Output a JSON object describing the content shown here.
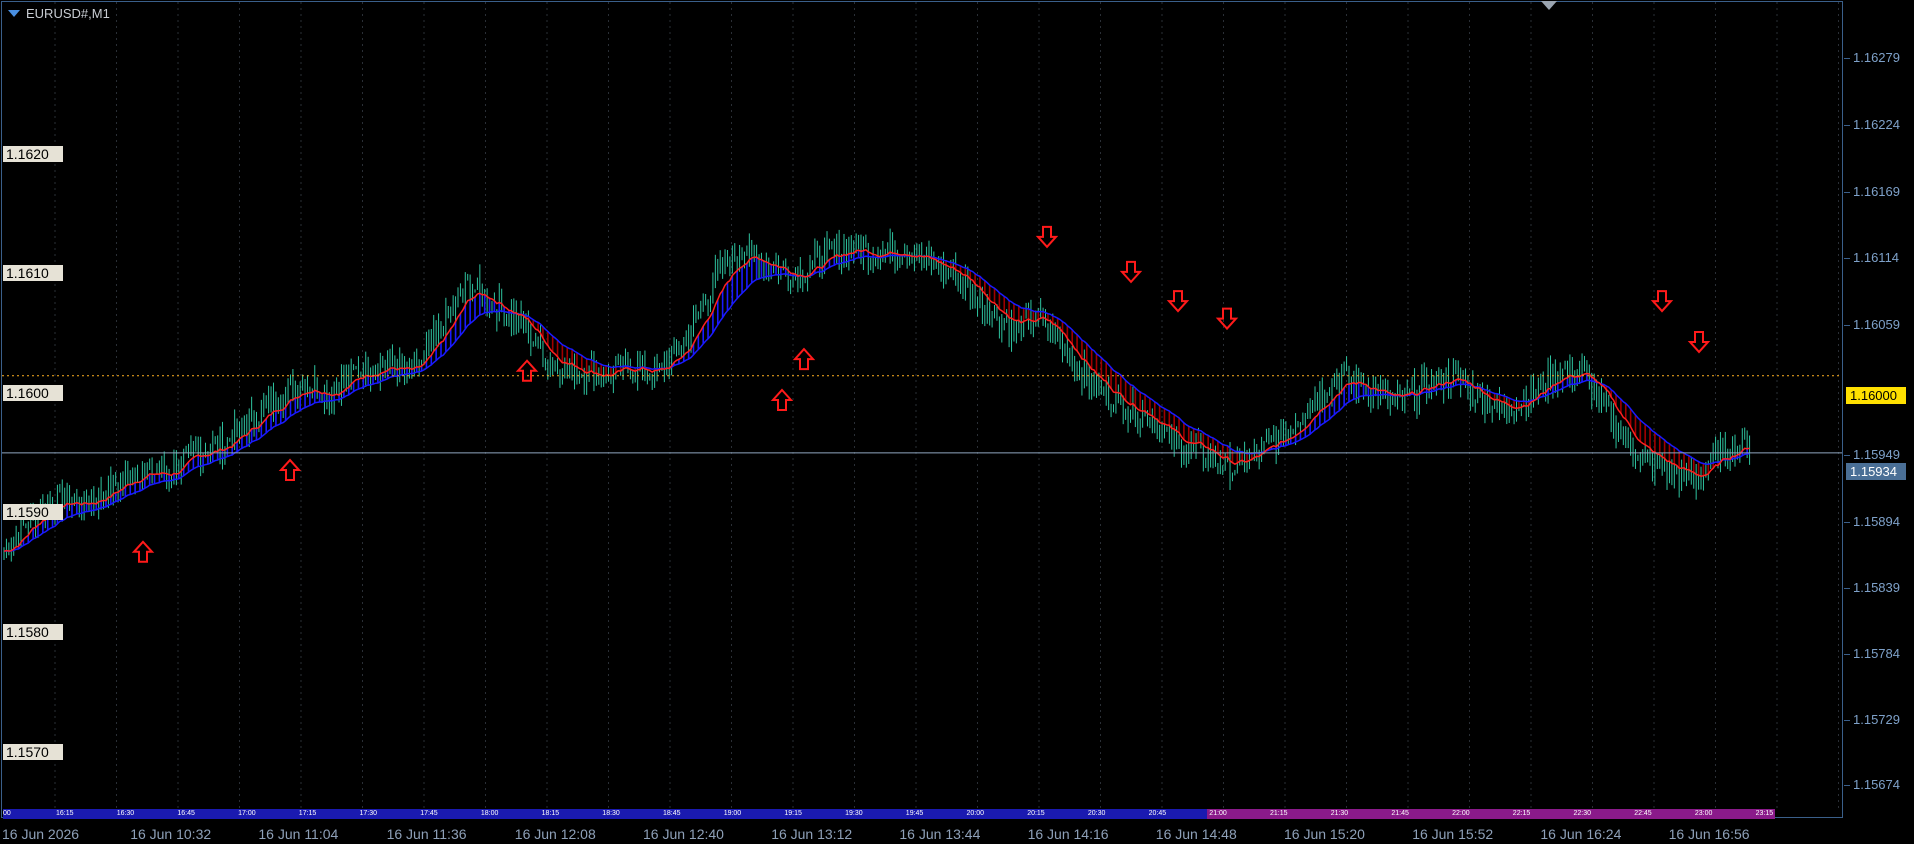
{
  "window": {
    "symbol_title": "EURUSD#,M1"
  },
  "colors": {
    "background": "#000000",
    "candle": "#2ec4a0",
    "ma_fast": "#ff2020",
    "ma_slow": "#1a1aff",
    "fill_up": "#1a1aff",
    "fill_down": "#a00000",
    "signal_arrow": "#ff1a1a",
    "round_level_line": "#ffb020",
    "current_price_line": "#8fa7bf",
    "session_blue": "#1a1ab0",
    "session_purple": "#8a1a8a"
  },
  "price_scale": {
    "labels": [
      "1.16279",
      "1.16224",
      "1.16169",
      "1.16114",
      "1.16059",
      "1.15949",
      "1.15894",
      "1.15839",
      "1.15784",
      "1.15729",
      "1.15674"
    ],
    "current_price": "1.15934",
    "round_level": "1.16000"
  },
  "level_tags": [
    "1.1620",
    "1.1610",
    "1.1600",
    "1.1590",
    "1.1580",
    "1.1570"
  ],
  "session_bar": {
    "labels": [
      "00",
      "16:15",
      "16:30",
      "16:45",
      "17:00",
      "17:15",
      "17:30",
      "17:45",
      "18:00",
      "18:15",
      "18:30",
      "18:45",
      "19:00",
      "19:15",
      "19:30",
      "19:45",
      "20:00",
      "20:15",
      "20:30",
      "20:45",
      "21:00",
      "21:15",
      "21:30",
      "21:45",
      "22:00",
      "22:15",
      "22:30",
      "22:45",
      "23:00",
      "23:15"
    ]
  },
  "time_axis": {
    "labels": [
      "16 Jun 2026",
      "16 Jun 10:32",
      "16 Jun 11:04",
      "16 Jun 11:36",
      "16 Jun 12:08",
      "16 Jun 12:40",
      "16 Jun 13:12",
      "16 Jun 13:44",
      "16 Jun 14:16",
      "16 Jun 14:48",
      "16 Jun 15:20",
      "16 Jun 15:52",
      "16 Jun 16:24",
      "16 Jun 16:56"
    ]
  },
  "chart_data": {
    "type": "line",
    "symbol": "EURUSD#",
    "timeframe": "M1",
    "ylim": [
      1.1563,
      1.1632
    ],
    "x": [
      "16 Jun 2026",
      "16 Jun 10:32",
      "16 Jun 11:04",
      "16 Jun 11:36",
      "16 Jun 12:08",
      "16 Jun 12:40",
      "16 Jun 13:12",
      "16 Jun 13:44",
      "16 Jun 14:16",
      "16 Jun 14:48",
      "16 Jun 15:20",
      "16 Jun 15:52",
      "16 Jun 16:24",
      "16 Jun 16:56"
    ],
    "price_path": [
      1.1585,
      1.1588,
      1.15895,
      1.1589,
      1.15905,
      1.1592,
      1.15915,
      1.15935,
      1.1594,
      1.1596,
      1.1598,
      1.15995,
      1.15985,
      1.16005,
      1.1601,
      1.16,
      1.1604,
      1.1608,
      1.1606,
      1.16045,
      1.1601,
      1.16005,
      1.16,
      1.16008,
      1.16002,
      1.1603,
      1.1608,
      1.1611,
      1.16095,
      1.16085,
      1.161,
      1.1611,
      1.16105,
      1.1611,
      1.16095,
      1.16085,
      1.1606,
      1.1604,
      1.1605,
      1.1602,
      1.1599,
      1.15975,
      1.15965,
      1.1594,
      1.15935,
      1.1592,
      1.15935,
      1.1595,
      1.1598,
      1.16,
      1.1599,
      1.15975,
      1.1599,
      1.16,
      1.15985,
      1.1597,
      1.15985,
      1.16005,
      1.16,
      1.1596,
      1.1593,
      1.1592,
      1.1591,
      1.15935,
      1.15945
    ],
    "buy_arrow_prices": [
      1.15875,
      1.15945,
      1.1603,
      1.16005,
      1.1604
    ],
    "sell_arrow_prices": [
      1.16095,
      1.16065,
      1.1604,
      1.16025,
      1.1604,
      1.16005
    ]
  }
}
